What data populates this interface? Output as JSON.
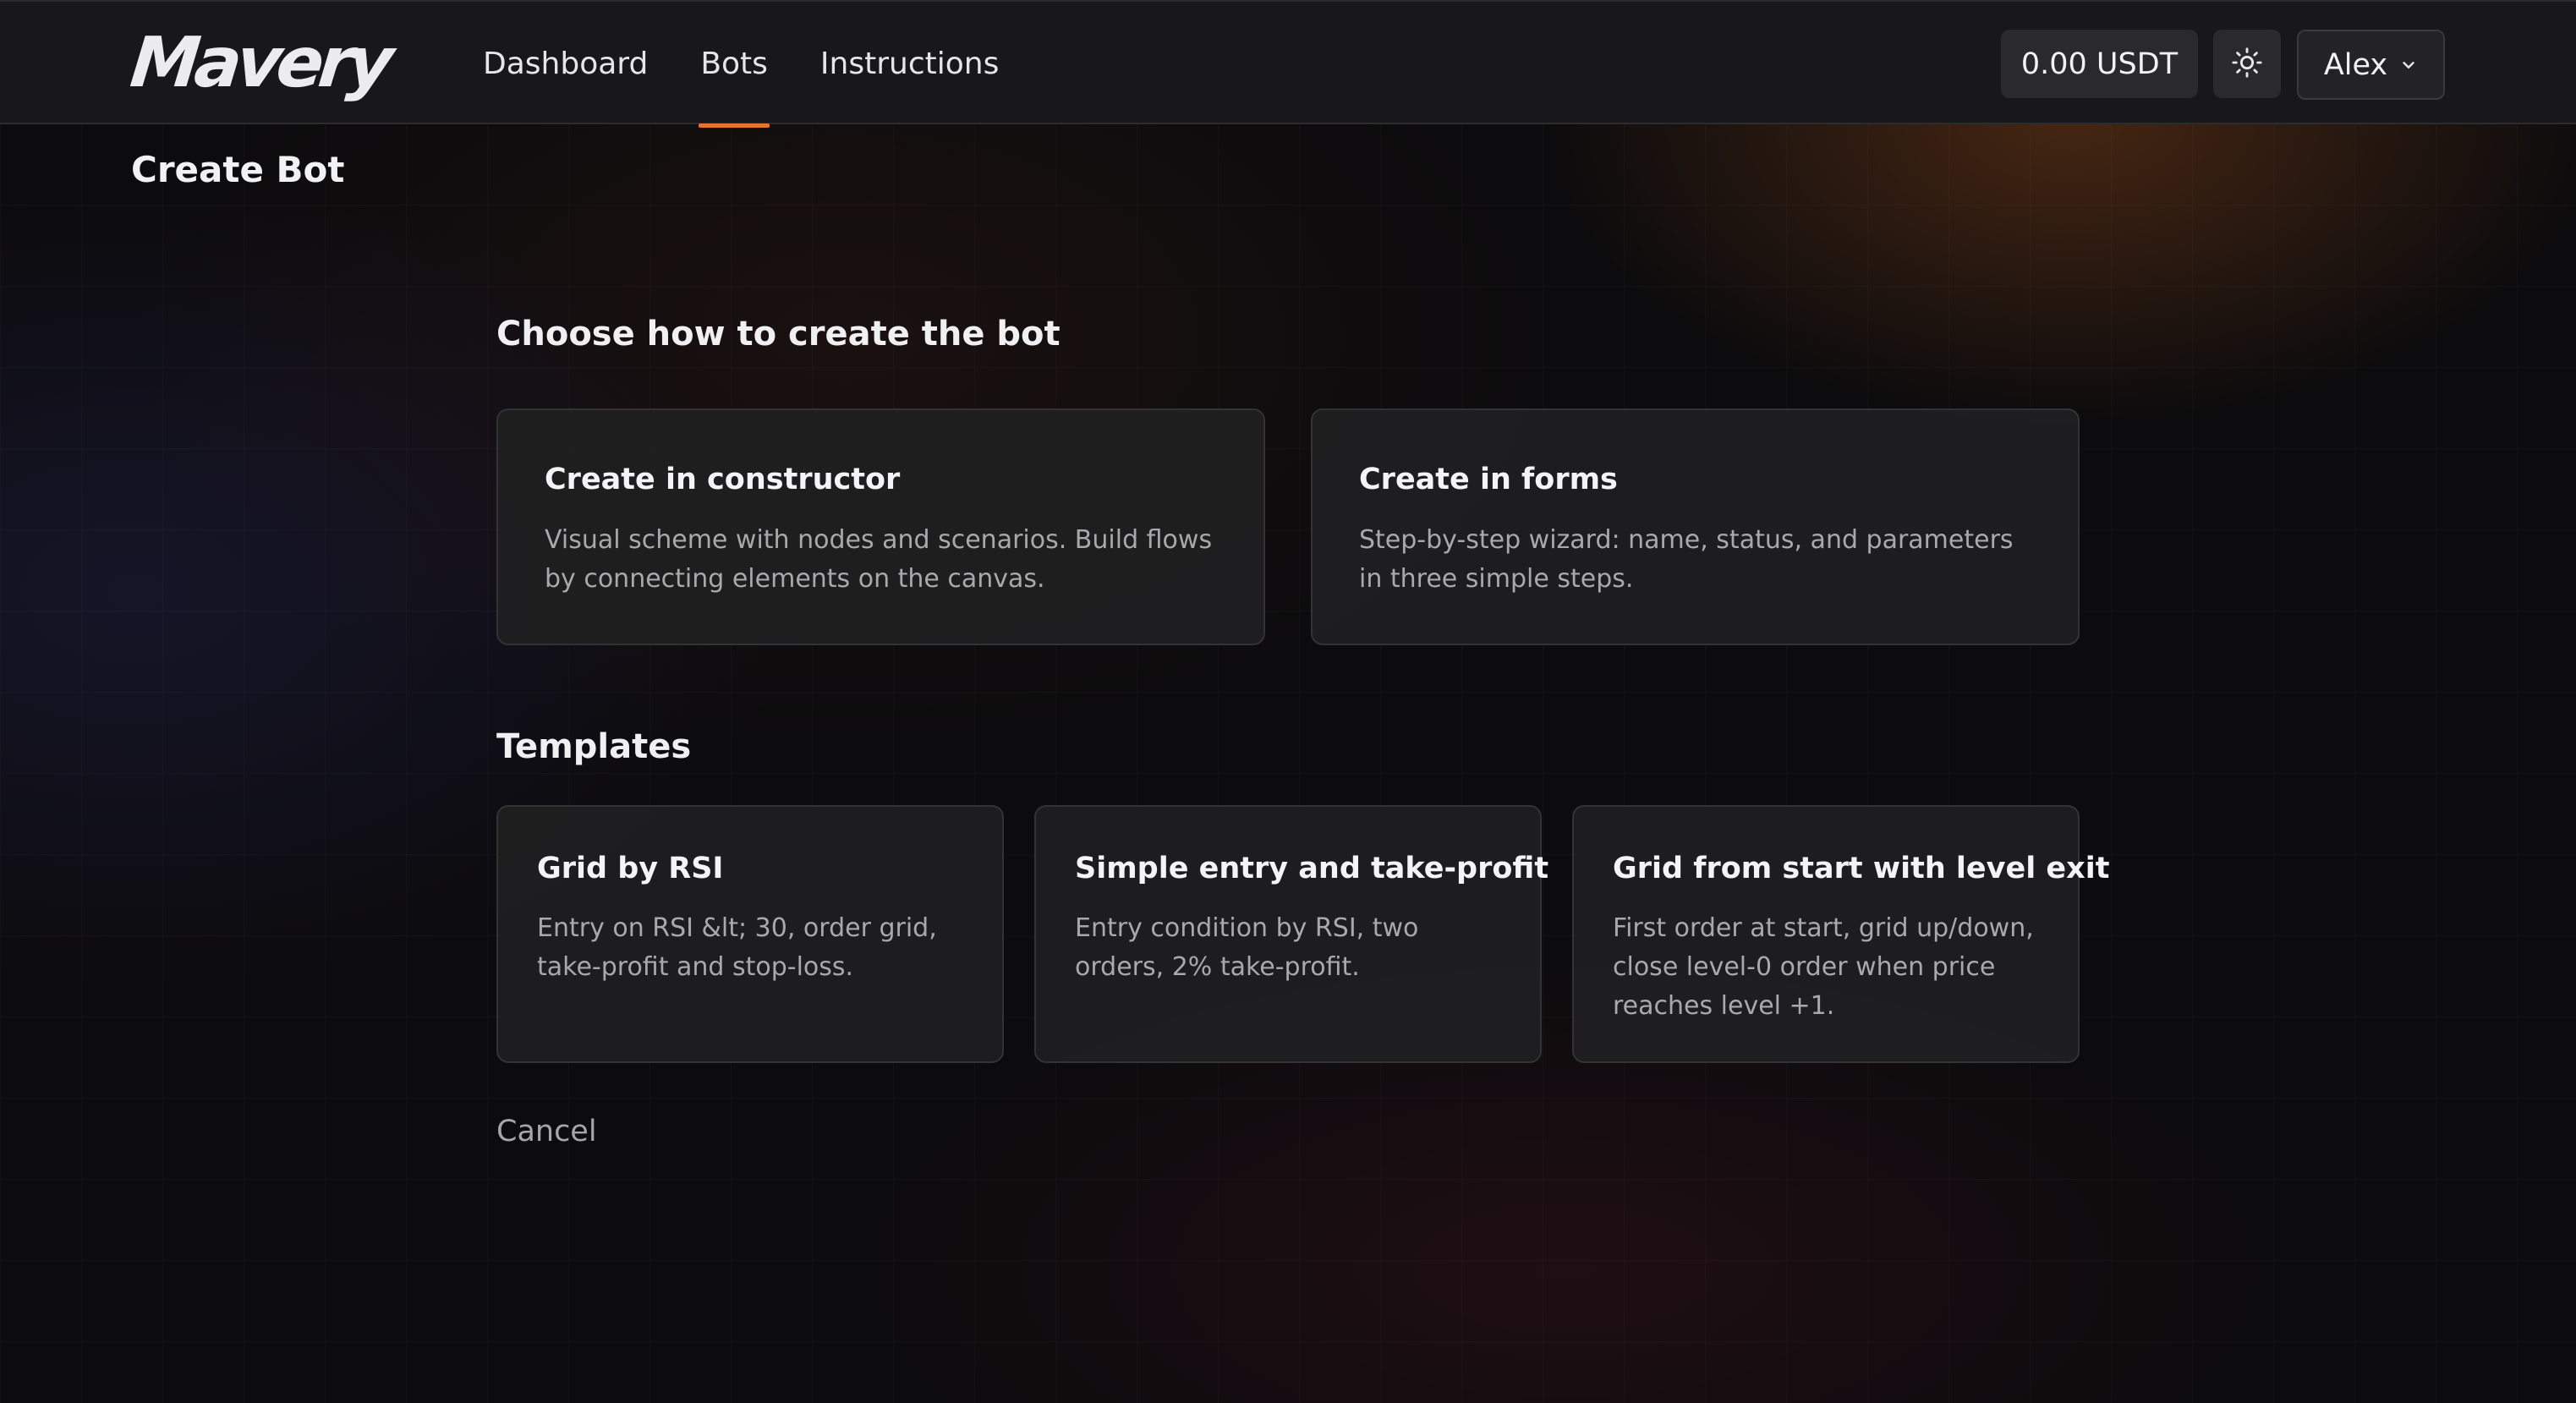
{
  "header": {
    "logo_text": "Mavery",
    "nav": [
      {
        "label": "Dashboard"
      },
      {
        "label": "Bots",
        "active": true
      },
      {
        "label": "Instructions"
      }
    ],
    "balance": "0.00 USDT",
    "theme_icon": "sun-icon",
    "user_name": "Alex",
    "user_icon": "chevron-down-icon"
  },
  "page": {
    "title": "Create Bot"
  },
  "create_section": {
    "title": "Choose how to create the bot",
    "options": [
      {
        "title": "Create in constructor",
        "description": "Visual scheme with nodes and scenarios. Build flows by connecting elements on the canvas."
      },
      {
        "title": "Create in forms",
        "description": "Step-by-step wizard: name, status, and parameters in three simple steps."
      }
    ]
  },
  "templates_section": {
    "title": "Templates",
    "items": [
      {
        "title": "Grid by RSI",
        "description": "Entry on RSI &lt; 30, order grid, take-profit and stop-loss."
      },
      {
        "title": "Simple entry and take-profit",
        "description": "Entry condition by RSI, two orders, 2% take-profit."
      },
      {
        "title": "Grid from start with level exit",
        "description": "First order at start, grid up/down, close level-0 order when price reaches level +1."
      }
    ]
  },
  "actions": {
    "cancel_label": "Cancel"
  },
  "colors": {
    "accent": "#e5742a",
    "header_bg": "#18181a",
    "card_bg": "#201f21"
  }
}
